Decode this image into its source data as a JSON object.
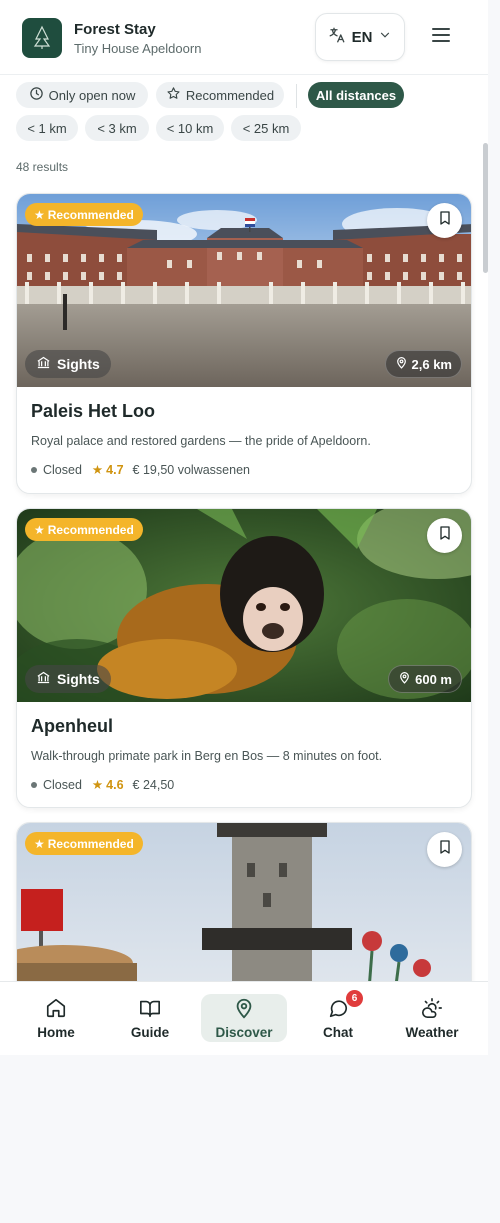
{
  "header": {
    "title": "Forest Stay",
    "subtitle": "Tiny House Apeldoorn",
    "language": "EN",
    "logo_text": "FOREST STAY"
  },
  "filters": {
    "open_now": "Only open now",
    "recommended": "Recommended",
    "all_distances": "All distances",
    "distances": [
      "< 1 km",
      "< 3 km",
      "< 10 km",
      "< 25 km"
    ]
  },
  "results_count": "48 results",
  "cards": [
    {
      "badge": "Recommended",
      "category": "Sights",
      "distance": "2,6 km",
      "title": "Paleis Het Loo",
      "description": "Royal palace and restored gardens — the pride of Apeldoorn.",
      "status": "Closed",
      "rating": "4.7",
      "price": "€ 19,50 volwassenen"
    },
    {
      "badge": "Recommended",
      "category": "Sights",
      "distance": "600 m",
      "title": "Apenheul",
      "description": "Walk-through primate park in Berg en Bos — 8 minutes on foot.",
      "status": "Closed",
      "rating": "4.6",
      "price": "€ 24,50"
    },
    {
      "badge": "Recommended"
    }
  ],
  "nav": {
    "home": "Home",
    "guide": "Guide",
    "discover": "Discover",
    "chat": "Chat",
    "chat_badge": "6",
    "weather": "Weather"
  },
  "colors": {
    "brand": "#2e5848",
    "badge": "#f4b52a",
    "rating": "#d09410",
    "notification": "#e03c3c"
  }
}
